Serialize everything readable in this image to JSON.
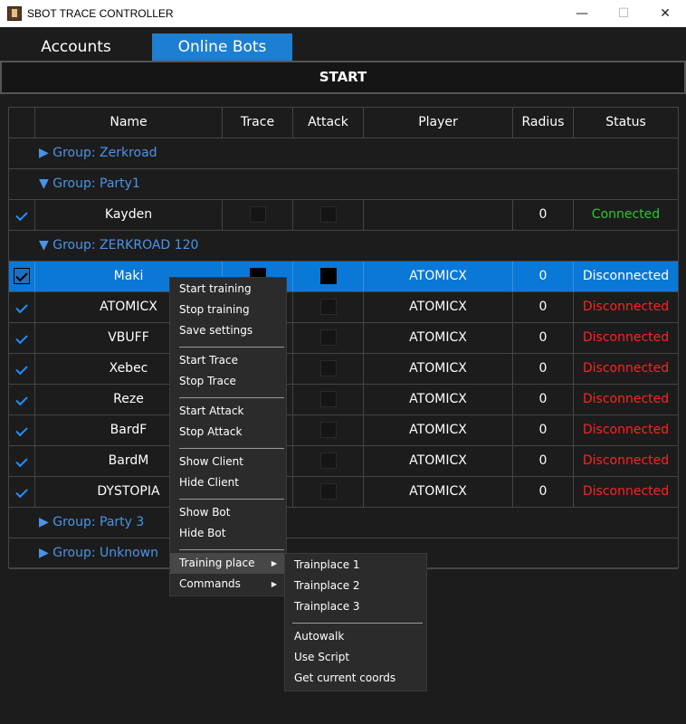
{
  "window": {
    "title": "SBOT TRACE CONTROLLER",
    "minimize": "—",
    "maximize": "☐",
    "close": "✕"
  },
  "tabs": [
    {
      "label": "Accounts",
      "active": false
    },
    {
      "label": "Online Bots",
      "active": true
    }
  ],
  "start_button": "START",
  "table": {
    "columns": [
      "",
      "Name",
      "Trace",
      "Attack",
      "Player",
      "Radius",
      "Status"
    ],
    "groups": [
      {
        "label": "▶ Group: Zerkroad"
      },
      {
        "label": "▼ Group: Party1"
      },
      {
        "label": "▼ Group: ZERKROAD 120"
      },
      {
        "label": "▶ Group: Party 3"
      },
      {
        "label": "▶ Group: Unknown"
      }
    ],
    "rows": [
      {
        "name": "Kayden",
        "player": "",
        "radius": "0",
        "status": "Connected"
      },
      {
        "name": "Maki",
        "player": "ATOMICX",
        "radius": "0",
        "status": "Disconnected"
      },
      {
        "name": "ATOMICX",
        "player": "ATOMICX",
        "radius": "0",
        "status": "Disconnected"
      },
      {
        "name": "VBUFF",
        "player": "ATOMICX",
        "radius": "0",
        "status": "Disconnected"
      },
      {
        "name": "Xebec",
        "player": "ATOMICX",
        "radius": "0",
        "status": "Disconnected"
      },
      {
        "name": "Reze",
        "player": "ATOMICX",
        "radius": "0",
        "status": "Disconnected"
      },
      {
        "name": "BardF",
        "player": "ATOMICX",
        "radius": "0",
        "status": "Disconnected"
      },
      {
        "name": "BardM",
        "player": "ATOMICX",
        "radius": "0",
        "status": "Disconnected"
      },
      {
        "name": "DYSTOPIA",
        "player": "ATOMICX",
        "radius": "0",
        "status": "Disconnected"
      }
    ]
  },
  "context_menu": {
    "items": [
      "Start training",
      "Stop training",
      "Save settings",
      "Start Trace",
      "Stop Trace",
      "Start Attack",
      "Stop Attack",
      "Show Client",
      "Hide Client",
      "Show Bot",
      "Hide Bot",
      "Training place",
      "Commands"
    ],
    "submenu_arrow": "▶"
  },
  "submenu": {
    "items": [
      "Trainplace 1",
      "Trainplace 2",
      "Trainplace 3",
      "Autowalk",
      "Use Script",
      "Get current coords"
    ]
  },
  "colors": {
    "accent": "#1e7ed2",
    "group_text": "#4a94e8",
    "connected": "#2fc42f",
    "disconnected": "#ff2222",
    "selected_row": "#0a78d7"
  }
}
